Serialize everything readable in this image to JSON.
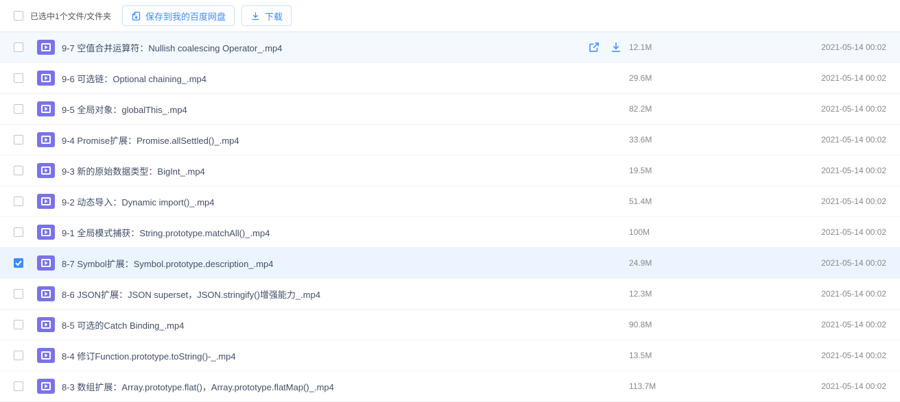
{
  "header": {
    "selection_label": "已选中1个文件/文件夹",
    "save_button": "保存到我的百度网盘",
    "download_button": "下载"
  },
  "files": [
    {
      "name": "9-7 空值合并运算符：Nullish coalescing Operator_.mp4",
      "size": "12.1M",
      "date": "2021-05-14 00:02",
      "selected": false,
      "hover": true
    },
    {
      "name": "9-6 可选链：Optional chaining_.mp4",
      "size": "29.6M",
      "date": "2021-05-14 00:02",
      "selected": false,
      "hover": false
    },
    {
      "name": "9-5 全局对象：globalThis_.mp4",
      "size": "82.2M",
      "date": "2021-05-14 00:02",
      "selected": false,
      "hover": false
    },
    {
      "name": "9-4 Promise扩展：Promise.allSettled()_.mp4",
      "size": "33.6M",
      "date": "2021-05-14 00:02",
      "selected": false,
      "hover": false
    },
    {
      "name": "9-3 新的原始数据类型：BigInt_.mp4",
      "size": "19.5M",
      "date": "2021-05-14 00:02",
      "selected": false,
      "hover": false
    },
    {
      "name": "9-2 动态导入：Dynamic import()_.mp4",
      "size": "51.4M",
      "date": "2021-05-14 00:02",
      "selected": false,
      "hover": false
    },
    {
      "name": "9-1 全局模式捕获：String.prototype.matchAll()_.mp4",
      "size": "100M",
      "date": "2021-05-14 00:02",
      "selected": false,
      "hover": false
    },
    {
      "name": "8-7 Symbol扩展：Symbol.prototype.description_.mp4",
      "size": "24.9M",
      "date": "2021-05-14 00:02",
      "selected": true,
      "hover": false
    },
    {
      "name": "8-6 JSON扩展：JSON superset，JSON.stringify()增强能力_.mp4",
      "size": "12.3M",
      "date": "2021-05-14 00:02",
      "selected": false,
      "hover": false
    },
    {
      "name": "8-5 可选的Catch Binding_.mp4",
      "size": "90.8M",
      "date": "2021-05-14 00:02",
      "selected": false,
      "hover": false
    },
    {
      "name": "8-4 修订Function.prototype.toString()-_.mp4",
      "size": "13.5M",
      "date": "2021-05-14 00:02",
      "selected": false,
      "hover": false
    },
    {
      "name": "8-3 数组扩展：Array.prototype.flat()，Array.prototype.flatMap()_.mp4",
      "size": "113.7M",
      "date": "2021-05-14 00:02",
      "selected": false,
      "hover": false
    }
  ]
}
